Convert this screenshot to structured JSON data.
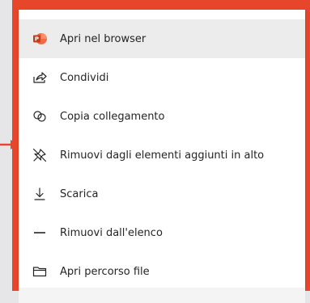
{
  "menu": {
    "items": [
      {
        "label": "Apri nel browser",
        "icon": "powerpoint-icon"
      },
      {
        "label": "Condividi",
        "icon": "share-icon"
      },
      {
        "label": "Copia collegamento",
        "icon": "link-icon"
      },
      {
        "label": "Rimuovi dagli elementi aggiunti in alto",
        "icon": "unpin-icon"
      },
      {
        "label": "Scarica",
        "icon": "download-icon"
      },
      {
        "label": "Rimuovi dall'elenco",
        "icon": "remove-icon"
      },
      {
        "label": "Apri percorso file",
        "icon": "folder-icon"
      }
    ]
  },
  "colors": {
    "highlight": "#e8462a",
    "powerpoint_brand": "#d24726",
    "selected_row": "#ececec"
  }
}
